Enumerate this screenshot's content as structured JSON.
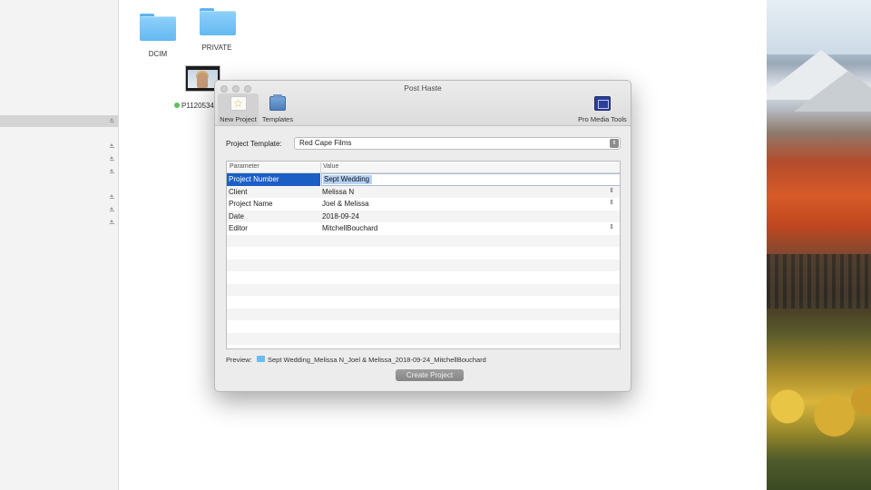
{
  "finder": {
    "folders": [
      {
        "name": "DCIM"
      },
      {
        "name": "PRIVATE"
      }
    ],
    "video_file": {
      "name": "P1120534"
    }
  },
  "window": {
    "title": "Post Haste",
    "toolbar": {
      "new_project": "New Project",
      "templates": "Templates",
      "pro_media_tools": "Pro Media Tools"
    },
    "project_template": {
      "label": "Project Template:",
      "value": "Red Cape Films"
    },
    "table": {
      "headers": {
        "parameter": "Parameter",
        "value": "Value"
      },
      "rows": [
        {
          "parameter": "Project Number",
          "value": "Sept Wedding"
        },
        {
          "parameter": "Client",
          "value": "Melissa N"
        },
        {
          "parameter": "Project Name",
          "value": "Joel & Melissa"
        },
        {
          "parameter": "Date",
          "value": "2018-09-24"
        },
        {
          "parameter": "Editor",
          "value": "MitchellBouchard"
        }
      ]
    },
    "preview": {
      "label": "Preview:",
      "path": "Sept Wedding_Melissa N_Joel & Melissa_2018-09-24_MitchellBouchard"
    },
    "create_button": "Create Project"
  },
  "colors": {
    "selection_blue": "#1b5fc5",
    "folder_blue": "#64b9f1",
    "green_tag": "#5cc35a"
  }
}
